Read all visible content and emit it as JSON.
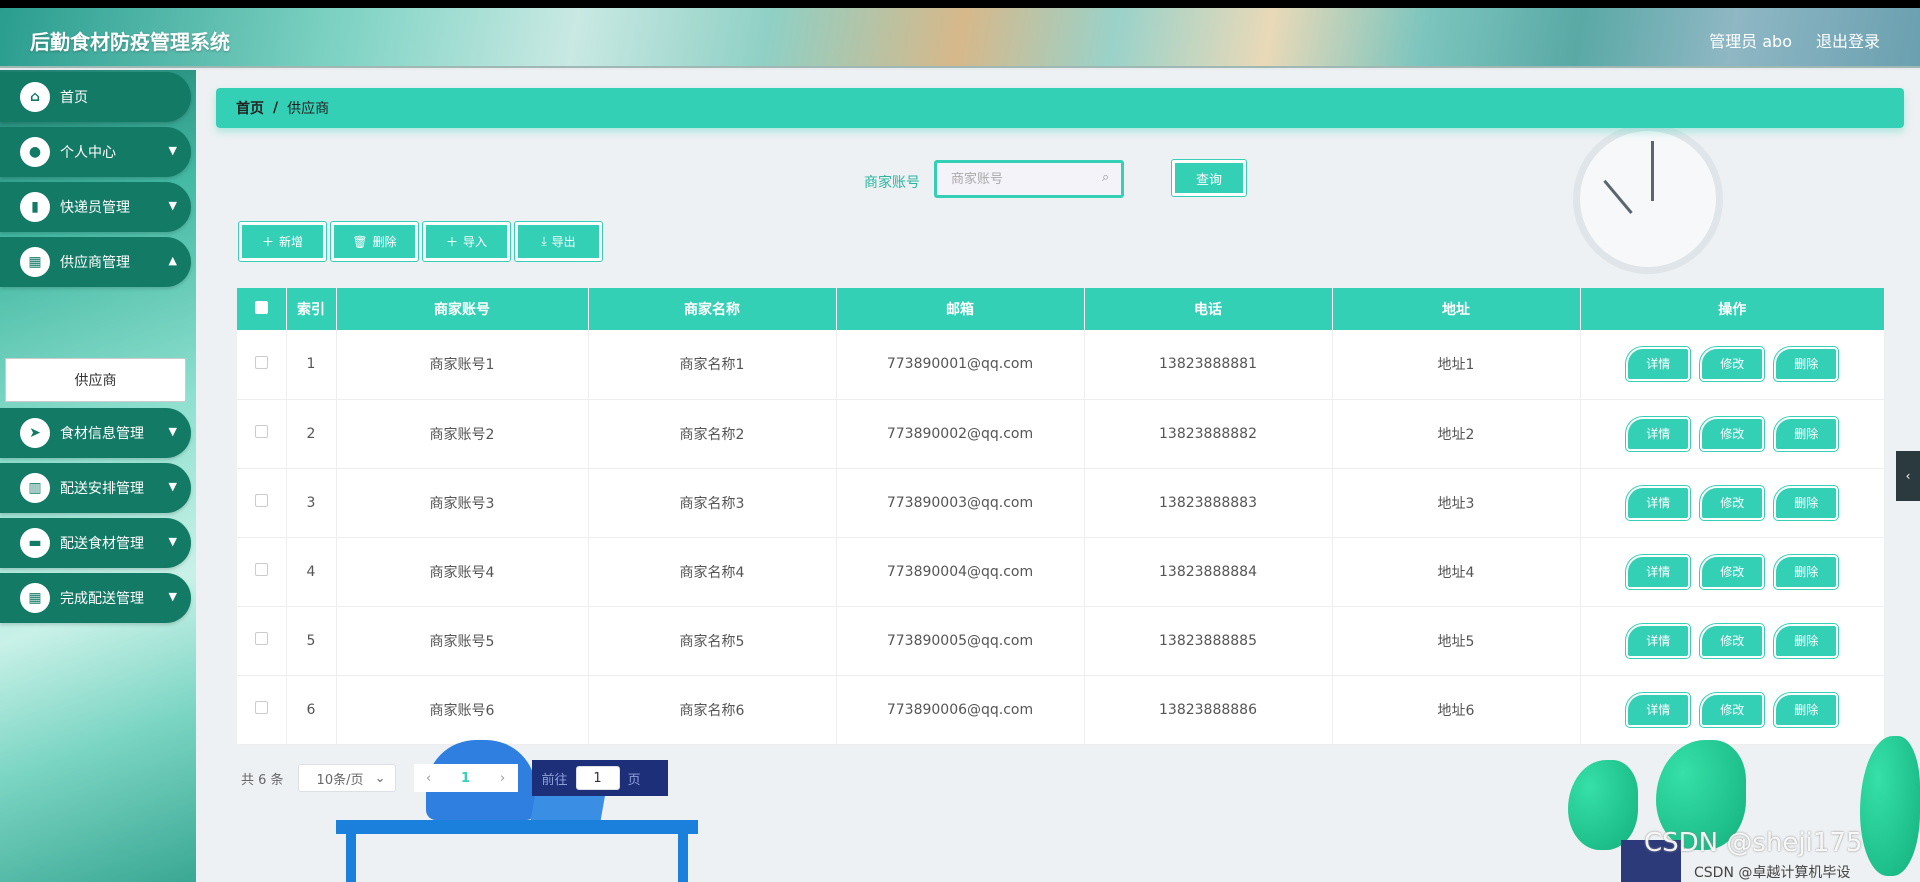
{
  "header": {
    "app_title": "后勤食材防疫管理系统",
    "user_label": "管理员 abo",
    "logout_label": "退出登录"
  },
  "sidebar": {
    "items": [
      {
        "label": "首页",
        "icon": "home-icon"
      },
      {
        "label": "个人中心",
        "icon": "user-icon"
      },
      {
        "label": "快递员管理",
        "icon": "book-icon"
      },
      {
        "label": "供应商管理",
        "icon": "grid-icon"
      },
      {
        "label": "食材信息管理",
        "icon": "send-icon"
      },
      {
        "label": "配送安排管理",
        "icon": "bar-chart-icon"
      },
      {
        "label": "配送食材管理",
        "icon": "message-icon"
      },
      {
        "label": "完成配送管理",
        "icon": "grid-icon"
      }
    ],
    "active_sub_item": "供应商"
  },
  "breadcrumb": {
    "home": "首页",
    "separator": "/",
    "current": "供应商"
  },
  "search": {
    "label": "商家账号",
    "placeholder": "商家账号",
    "button": "查询"
  },
  "actions": {
    "add": "新增",
    "delete": "删除",
    "import": "导入",
    "export": "导出"
  },
  "table": {
    "headers": [
      "索引",
      "商家账号",
      "商家名称",
      "邮箱",
      "电话",
      "地址",
      "操作"
    ],
    "rows": [
      {
        "index": "1",
        "account": "商家账号1",
        "name": "商家名称1",
        "email": "773890001@qq.com",
        "phone": "13823888881",
        "address": "地址1"
      },
      {
        "index": "2",
        "account": "商家账号2",
        "name": "商家名称2",
        "email": "773890002@qq.com",
        "phone": "13823888882",
        "address": "地址2"
      },
      {
        "index": "3",
        "account": "商家账号3",
        "name": "商家名称3",
        "email": "773890003@qq.com",
        "phone": "13823888883",
        "address": "地址3"
      },
      {
        "index": "4",
        "account": "商家账号4",
        "name": "商家名称4",
        "email": "773890004@qq.com",
        "phone": "13823888884",
        "address": "地址4"
      },
      {
        "index": "5",
        "account": "商家账号5",
        "name": "商家名称5",
        "email": "773890005@qq.com",
        "phone": "13823888885",
        "address": "地址5"
      },
      {
        "index": "6",
        "account": "商家账号6",
        "name": "商家名称6",
        "email": "773890006@qq.com",
        "phone": "13823888886",
        "address": "地址6"
      }
    ],
    "row_actions": {
      "detail": "详情",
      "edit": "修改",
      "delete": "删除"
    }
  },
  "pagination": {
    "total": "共 6 条",
    "page_size": "10条/页",
    "current_page": "1",
    "goto_prefix": "前往",
    "goto_value": "1",
    "goto_suffix": "页"
  },
  "watermark": {
    "main": "CSDN @sheji175",
    "sub": "CSDN @卓越计算机毕设"
  },
  "colors": {
    "accent": "#33d0b6",
    "sidebar_item": "#137a66",
    "header_text": "#ffffff"
  }
}
